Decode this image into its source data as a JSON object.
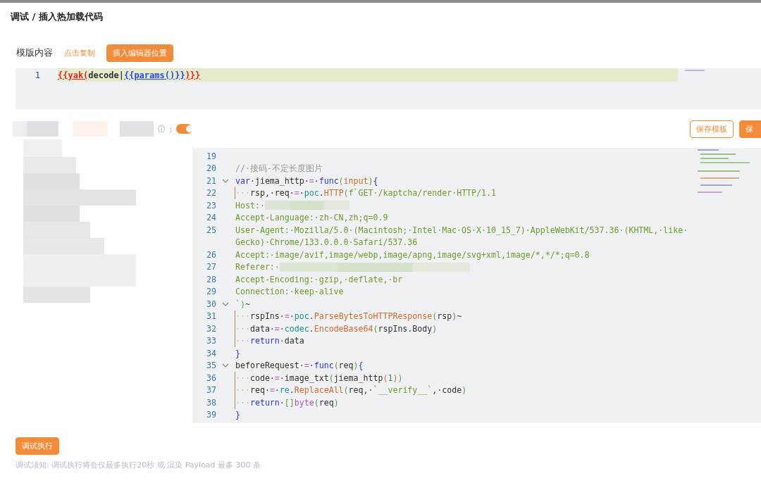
{
  "window": {
    "title": "调试 / 插入热加载代码"
  },
  "template": {
    "label": "模版内容",
    "copy_link": "点击复制",
    "insert_button": "插入编辑器位置",
    "lines": [
      {
        "number": "1",
        "tokens": [
          {
            "kind": "tpl-red",
            "text": "{{yak("
          },
          {
            "kind": "plain",
            "text": "decode|"
          },
          {
            "kind": "tpl-blue",
            "text": "{{params()}}"
          },
          {
            "kind": "tpl-red",
            "text": ")}}"
          }
        ]
      }
    ]
  },
  "controls": {
    "info_colon": ":",
    "hot_reload_on": true,
    "save_template_button": "保存模板",
    "save_button": "保"
  },
  "editor": {
    "lines": [
      {
        "number": "19",
        "fold": false,
        "guide": false
      },
      {
        "number": "20",
        "fold": false,
        "guide": false,
        "tokens": [
          {
            "kind": "comment",
            "text": "//·接码-不定长度图片"
          }
        ]
      },
      {
        "number": "21",
        "fold": true,
        "guide": false,
        "tokens": [
          {
            "kind": "kw",
            "text": "var"
          },
          {
            "kind": "plain",
            "text": "·jiema_http·"
          },
          {
            "kind": "op",
            "text": "="
          },
          {
            "kind": "plain",
            "text": "·"
          },
          {
            "kind": "kw",
            "text": "func"
          },
          {
            "kind": "paren",
            "text": "("
          },
          {
            "kind": "fn",
            "text": "input"
          },
          {
            "kind": "paren",
            "text": ")"
          },
          {
            "kind": "kw",
            "text": "{"
          }
        ]
      },
      {
        "number": "22",
        "fold": false,
        "guide": true,
        "tokens": [
          {
            "kind": "ws",
            "text": "···"
          },
          {
            "kind": "plain",
            "text": "rsp,·req·"
          },
          {
            "kind": "op",
            "text": "="
          },
          {
            "kind": "plain",
            "text": "·"
          },
          {
            "kind": "pkg",
            "text": "poc"
          },
          {
            "kind": "plain",
            "text": "."
          },
          {
            "kind": "fn",
            "text": "HTTP"
          },
          {
            "kind": "paren",
            "text": "("
          },
          {
            "kind": "str",
            "text": "f`GET·/kaptcha/render·HTTP/1.1"
          }
        ]
      },
      {
        "number": "23",
        "fold": false,
        "guide": false,
        "tokens": [
          {
            "kind": "str",
            "text": "Host:·"
          },
          {
            "kind": "redacted-short"
          }
        ]
      },
      {
        "number": "24",
        "fold": false,
        "guide": false,
        "tokens": [
          {
            "kind": "str",
            "text": "Accept-Language:·zh-CN,zh;q=0.9"
          }
        ]
      },
      {
        "number": "25",
        "fold": false,
        "guide": false,
        "tokens": [
          {
            "kind": "str",
            "text": "User-Agent:·Mozilla/5.0·(Macintosh;·Intel·Mac·OS·X·10_15_7)·AppleWebKit/537.36·(KHTML,·like·"
          }
        ],
        "continuation": [
          {
            "kind": "str",
            "text": "Gecko)·Chrome/133.0.0.0·Safari/537.36"
          }
        ]
      },
      {
        "number": "26",
        "fold": false,
        "guide": false,
        "tokens": [
          {
            "kind": "str",
            "text": "Accept:·image/avif,image/webp,image/apng,image/svg+xml,image/*,*/*;q=0.8"
          }
        ]
      },
      {
        "number": "27",
        "fold": false,
        "guide": false,
        "tokens": [
          {
            "kind": "str",
            "text": "Referer:·"
          },
          {
            "kind": "redacted-long"
          }
        ]
      },
      {
        "number": "28",
        "fold": false,
        "guide": false,
        "tokens": [
          {
            "kind": "str",
            "text": "Accept-Encoding:·gzip,·deflate,·br"
          }
        ]
      },
      {
        "number": "29",
        "fold": false,
        "guide": false,
        "tokens": [
          {
            "kind": "str",
            "text": "Connection:·keep-alive"
          }
        ]
      },
      {
        "number": "30",
        "fold": true,
        "guide": false,
        "tokens": [
          {
            "kind": "str",
            "text": "`"
          },
          {
            "kind": "paren",
            "text": ")"
          },
          {
            "kind": "plain",
            "text": "~"
          }
        ]
      },
      {
        "number": "31",
        "fold": false,
        "guide": true,
        "tokens": [
          {
            "kind": "ws",
            "text": "···"
          },
          {
            "kind": "plain",
            "text": "rspIns·"
          },
          {
            "kind": "op",
            "text": "="
          },
          {
            "kind": "plain",
            "text": "·"
          },
          {
            "kind": "pkg",
            "text": "poc"
          },
          {
            "kind": "plain",
            "text": "."
          },
          {
            "kind": "fn",
            "text": "ParseBytesToHTTPResponse"
          },
          {
            "kind": "paren",
            "text": "("
          },
          {
            "kind": "plain",
            "text": "rsp"
          },
          {
            "kind": "paren",
            "text": ")"
          },
          {
            "kind": "plain",
            "text": "~"
          }
        ]
      },
      {
        "number": "32",
        "fold": false,
        "guide": true,
        "tokens": [
          {
            "kind": "ws",
            "text": "···"
          },
          {
            "kind": "plain",
            "text": "data·"
          },
          {
            "kind": "op",
            "text": "="
          },
          {
            "kind": "plain",
            "text": "·"
          },
          {
            "kind": "pkg",
            "text": "codec"
          },
          {
            "kind": "plain",
            "text": "."
          },
          {
            "kind": "fn",
            "text": "EncodeBase64"
          },
          {
            "kind": "paren",
            "text": "("
          },
          {
            "kind": "plain",
            "text": "rspIns.Body"
          },
          {
            "kind": "paren",
            "text": ")"
          }
        ]
      },
      {
        "number": "33",
        "fold": false,
        "guide": true,
        "tokens": [
          {
            "kind": "ws",
            "text": "···"
          },
          {
            "kind": "kw",
            "text": "return"
          },
          {
            "kind": "plain",
            "text": "·data"
          }
        ]
      },
      {
        "number": "34",
        "fold": false,
        "guide": false,
        "tokens": [
          {
            "kind": "kw",
            "text": "}"
          }
        ]
      },
      {
        "number": "35",
        "fold": true,
        "guide": false,
        "tokens": [
          {
            "kind": "plain",
            "text": "beforeRequest·"
          },
          {
            "kind": "op",
            "text": "="
          },
          {
            "kind": "plain",
            "text": "·"
          },
          {
            "kind": "kw",
            "text": "func"
          },
          {
            "kind": "paren",
            "text": "("
          },
          {
            "kind": "plain",
            "text": "req"
          },
          {
            "kind": "paren",
            "text": ")"
          },
          {
            "kind": "kw",
            "text": "{"
          }
        ]
      },
      {
        "number": "36",
        "fold": false,
        "guide": true,
        "tokens": [
          {
            "kind": "ws",
            "text": "···"
          },
          {
            "kind": "plain",
            "text": "code·"
          },
          {
            "kind": "op",
            "text": "="
          },
          {
            "kind": "plain",
            "text": "·image_txt"
          },
          {
            "kind": "paren",
            "text": "("
          },
          {
            "kind": "plain",
            "text": "jiema_http"
          },
          {
            "kind": "fn",
            "text": "("
          },
          {
            "kind": "num",
            "text": "1"
          },
          {
            "kind": "fn",
            "text": ")"
          },
          {
            "kind": "paren",
            "text": ")"
          }
        ]
      },
      {
        "number": "37",
        "fold": false,
        "guide": true,
        "tokens": [
          {
            "kind": "ws",
            "text": "···"
          },
          {
            "kind": "plain",
            "text": "req·"
          },
          {
            "kind": "op",
            "text": "="
          },
          {
            "kind": "plain",
            "text": "·"
          },
          {
            "kind": "pkg",
            "text": "re"
          },
          {
            "kind": "plain",
            "text": "."
          },
          {
            "kind": "fn",
            "text": "ReplaceAll"
          },
          {
            "kind": "paren",
            "text": "("
          },
          {
            "kind": "plain",
            "text": "req,·"
          },
          {
            "kind": "str",
            "text": "`__verify__`"
          },
          {
            "kind": "plain",
            "text": ",·code"
          },
          {
            "kind": "paren",
            "text": ")"
          }
        ]
      },
      {
        "number": "38",
        "fold": false,
        "guide": true,
        "tokens": [
          {
            "kind": "ws",
            "text": "···"
          },
          {
            "kind": "kw",
            "text": "return"
          },
          {
            "kind": "plain",
            "text": "·"
          },
          {
            "kind": "paren",
            "text": "[]"
          },
          {
            "kind": "op",
            "text": "byte"
          },
          {
            "kind": "paren",
            "text": "("
          },
          {
            "kind": "plain",
            "text": "req"
          },
          {
            "kind": "paren",
            "text": ")"
          }
        ]
      },
      {
        "number": "39",
        "fold": false,
        "guide": false,
        "tokens": [
          {
            "kind": "kw",
            "text": "}"
          }
        ]
      }
    ]
  },
  "footer": {
    "run_button": "调试执行",
    "note": "调试须知: 调试执行将会仅最多执行20秒 或 渲染 Payload 最多 300 条"
  }
}
